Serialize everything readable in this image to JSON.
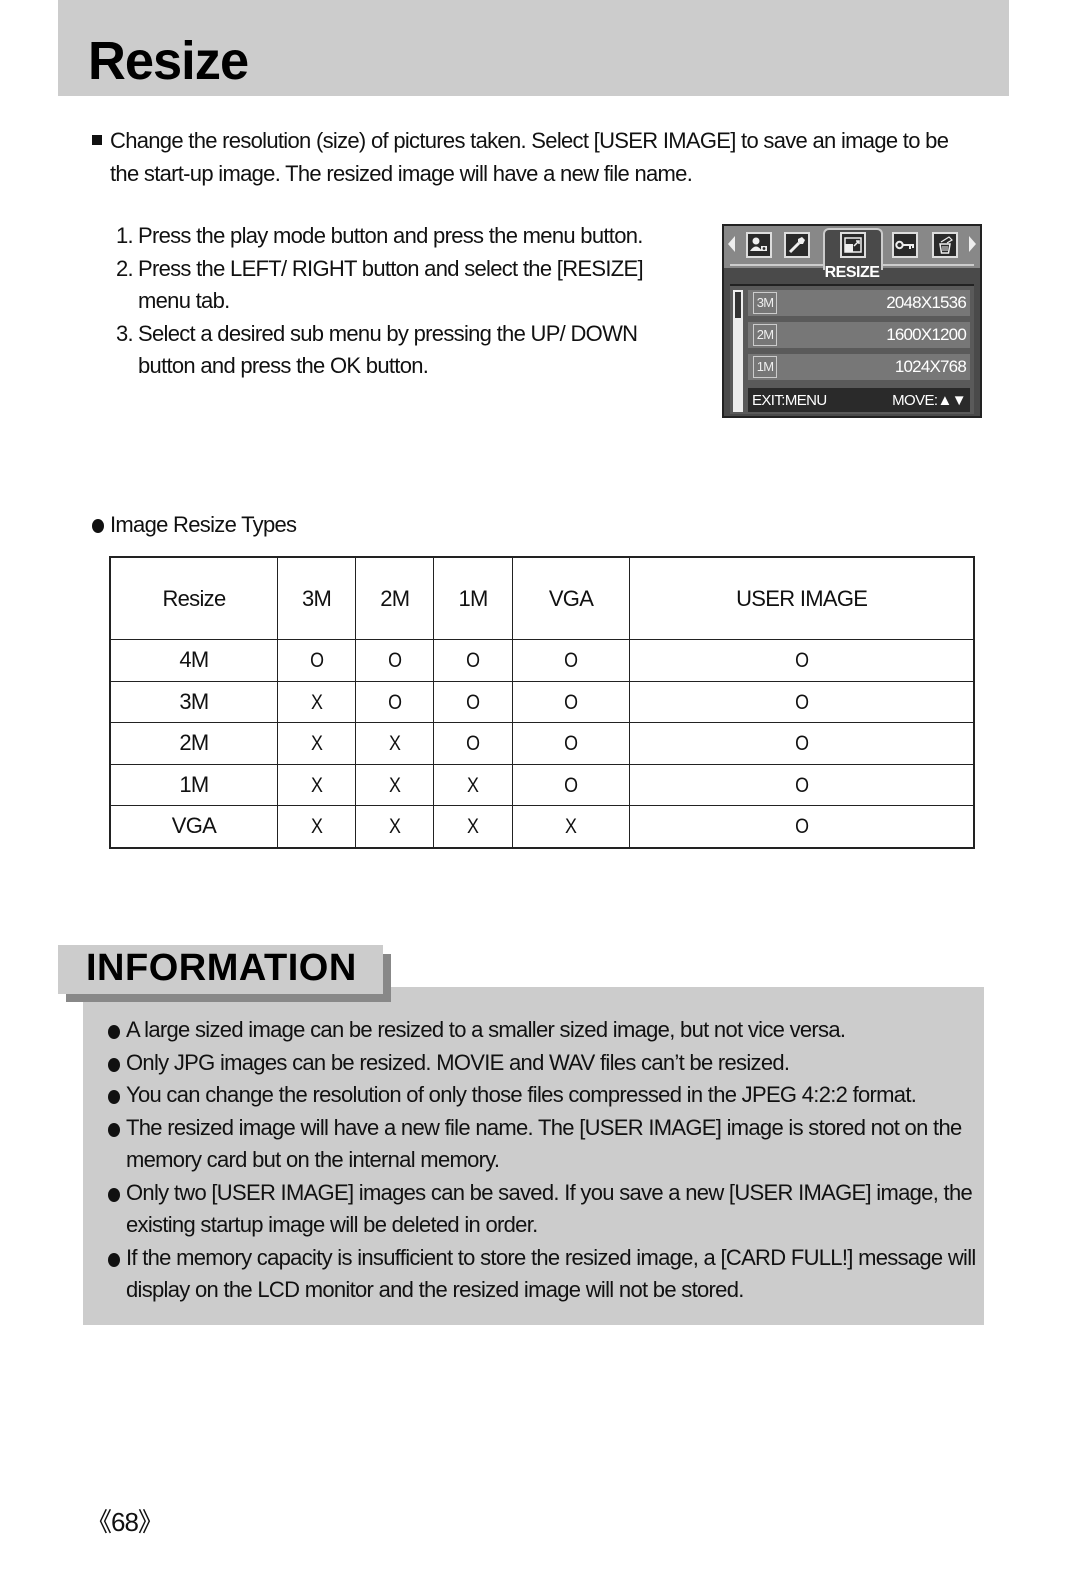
{
  "page": {
    "title": "Resize",
    "page_number": "《68》"
  },
  "intro": {
    "line1": "Change the resolution (size) of pictures taken. Select [USER IMAGE]  to save an image to be",
    "line2": "the start-up image. The resized image will have a new file name."
  },
  "steps": [
    {
      "num": "1.",
      "text": "Press the play mode button and press the menu button."
    },
    {
      "num": "2.",
      "text": "Press the LEFT/ RIGHT button and select the [RESIZE] menu tab."
    },
    {
      "num": "3.",
      "text": "Select a desired sub menu by pressing the UP/ DOWN button and press the OK button."
    }
  ],
  "lcd": {
    "tabs": [
      {
        "icon": "person-settings-icon",
        "glyph": "👤"
      },
      {
        "icon": "wrench-icon",
        "glyph": "🔧"
      },
      {
        "icon": "resize-icon",
        "glyph": "⇲"
      },
      {
        "icon": "key-protect-icon",
        "glyph": "⚷"
      },
      {
        "icon": "delete-icon",
        "glyph": "🗑"
      }
    ],
    "menu_title": "RESIZE",
    "items": [
      {
        "badge": "3M",
        "resolution": "2048X1536"
      },
      {
        "badge": "2M",
        "resolution": "1600X1200"
      },
      {
        "badge": "1M",
        "resolution": "1024X768"
      }
    ],
    "footer_exit": "EXIT:MENU",
    "footer_move": "MOVE:▲▼"
  },
  "resize_types": {
    "label": "Image Resize Types",
    "headers": [
      "Resize",
      "3M",
      "2M",
      "1M",
      "VGA",
      "USER IMAGE"
    ],
    "rows": [
      [
        "4M",
        "O",
        "O",
        "O",
        "O",
        "O"
      ],
      [
        "3M",
        "X",
        "O",
        "O",
        "O",
        "O"
      ],
      [
        "2M",
        "X",
        "X",
        "O",
        "O",
        "O"
      ],
      [
        "1M",
        "X",
        "X",
        "X",
        "O",
        "O"
      ],
      [
        "VGA",
        "X",
        "X",
        "X",
        "X",
        "O"
      ]
    ]
  },
  "information": {
    "heading": "INFORMATION",
    "items": [
      "A large sized image can be resized to a smaller sized image, but not vice versa.",
      "Only JPG images can be resized. MOVIE and WAV files can’t be resized.",
      "You can change the resolution of only those files compressed in the JPEG 4:2:2 format.",
      "The resized image will have a new file name. The [USER IMAGE] image is stored not on the memory card but on the internal memory.",
      "Only two [USER IMAGE] images can be saved. If you save a new [USER IMAGE] image, the existing startup image will be deleted in order.",
      "If the memory capacity is insufficient to store the resized image, a [CARD FULL!] message will display on the LCD monitor and the resized image will not be stored."
    ]
  }
}
